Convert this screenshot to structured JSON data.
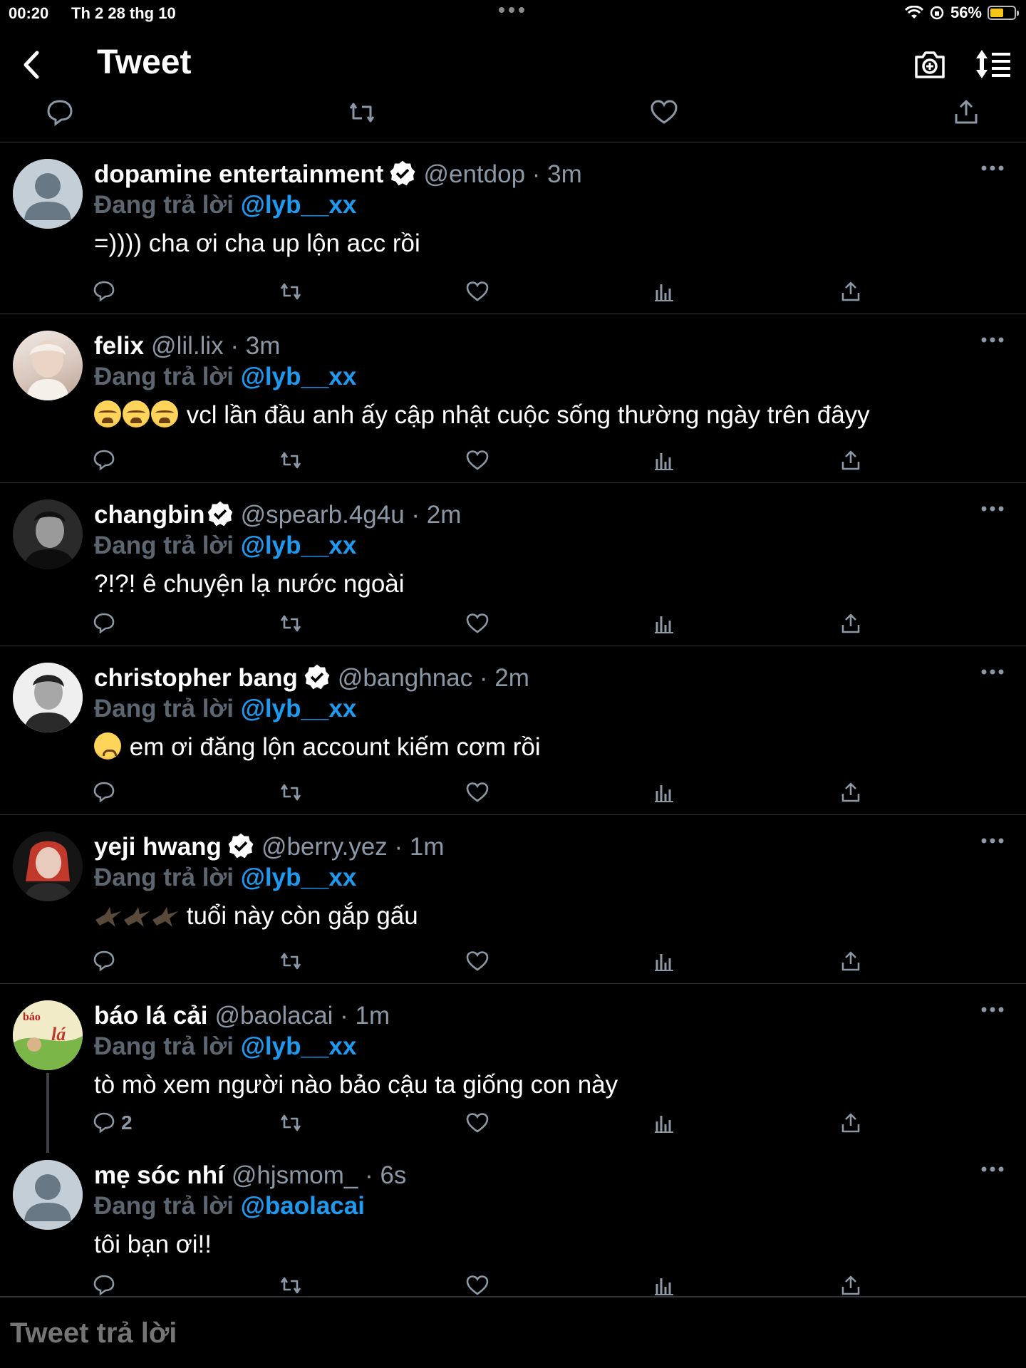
{
  "status_bar": {
    "time": "00:20",
    "date": "Th 2 28 thg 10",
    "battery": "56%",
    "battery_level": 0.56
  },
  "header": {
    "title": "Tweet"
  },
  "replies": [
    {
      "name": "dopamine entertainment",
      "verified": true,
      "handle": "@entdop · 3m",
      "replying_prefix": "Đang trả lời ",
      "replying_to": "@lyb__xx",
      "text": "=)))) cha ơi cha up lộn acc rồi",
      "avatar": "default-avatar"
    },
    {
      "name": "felix",
      "verified": false,
      "handle": "@lil.lix · 3m",
      "replying_prefix": "Đang trả lời ",
      "replying_to": "@lyb__xx",
      "text": "vcl lần đầu anh ấy cập nhật cuộc sống thường ngày trên đâyy",
      "emoji_prefix": "loudly-crying-face x3",
      "avatar": "photo"
    },
    {
      "name": "changbin",
      "verified": true,
      "handle": "@spearb.4g4u · 2m",
      "replying_prefix": "Đang trả lời ",
      "replying_to": "@lyb__xx",
      "text": "?!?! ê chuyện lạ nước ngoài",
      "avatar": "photo"
    },
    {
      "name": "christopher bang",
      "verified": true,
      "handle": "@banghnac · 2m",
      "replying_prefix": "Đang trả lời ",
      "replying_to": "@lyb__xx",
      "text": "em ơi đăng lộn account kiếm cơm rồi",
      "emoji_prefix": "worried-face",
      "avatar": "photo"
    },
    {
      "name": "yeji hwang",
      "verified": true,
      "handle": "@berry.yez · 1m",
      "replying_prefix": "Đang trả lời ",
      "replying_to": "@lyb__xx",
      "text": "tuổi này còn gắp gấu",
      "emoji_prefix": "eagle x3",
      "avatar": "photo"
    },
    {
      "name": "báo lá cải",
      "verified": false,
      "handle": "@baolacai · 1m",
      "replying_prefix": "Đang trả lời ",
      "replying_to": "@lyb__xx",
      "text": "tò mò xem người nào bảo cậu ta giống con này",
      "reply_count": "2",
      "avatar": "logo"
    },
    {
      "name": "mẹ sóc nhí",
      "verified": false,
      "handle": "@hjsmom_ · 6s",
      "replying_prefix": "Đang trả lời ",
      "replying_to": "@baolacai",
      "text": "tôi bạn ơi!!",
      "avatar": "default-avatar"
    }
  ],
  "composer": {
    "placeholder": "Tweet trả lời"
  },
  "colors": {
    "background": "#000000",
    "accent": "#1d9bf0",
    "muted": "#8b98a5",
    "divider": "#2f3336"
  },
  "icons": [
    "back-icon",
    "camera-plus-icon",
    "sort-icon",
    "reply-icon",
    "retweet-icon",
    "like-icon",
    "views-icon",
    "share-icon",
    "verified-icon",
    "more-icon"
  ]
}
